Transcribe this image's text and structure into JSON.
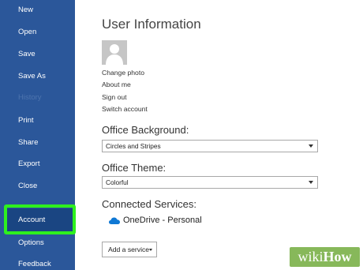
{
  "sidebar": {
    "items": [
      {
        "label": "New"
      },
      {
        "label": "Open"
      },
      {
        "label": "Save"
      },
      {
        "label": "Save As"
      },
      {
        "label": "History"
      },
      {
        "label": "Print"
      },
      {
        "label": "Share"
      },
      {
        "label": "Export"
      },
      {
        "label": "Close"
      },
      {
        "label": "Account"
      },
      {
        "label": "Options"
      },
      {
        "label": "Feedback"
      }
    ]
  },
  "user_info": {
    "title": "User Information",
    "links": [
      "Change photo",
      "About me",
      "Sign out",
      "Switch account"
    ]
  },
  "background": {
    "label": "Office Background:",
    "value": "Circles and Stripes"
  },
  "theme": {
    "label": "Office Theme:",
    "value": "Colorful"
  },
  "services": {
    "label": "Connected Services:",
    "items": [
      {
        "name": "OneDrive - Personal",
        "icon": "onedrive-cloud-icon"
      }
    ],
    "add_label": "Add a service"
  },
  "colors": {
    "sidebar": "#2b579a",
    "highlight": "#2ef01e",
    "onedrive": "#0f78d4"
  },
  "watermark": {
    "part1": "wiki",
    "part2": "How"
  }
}
